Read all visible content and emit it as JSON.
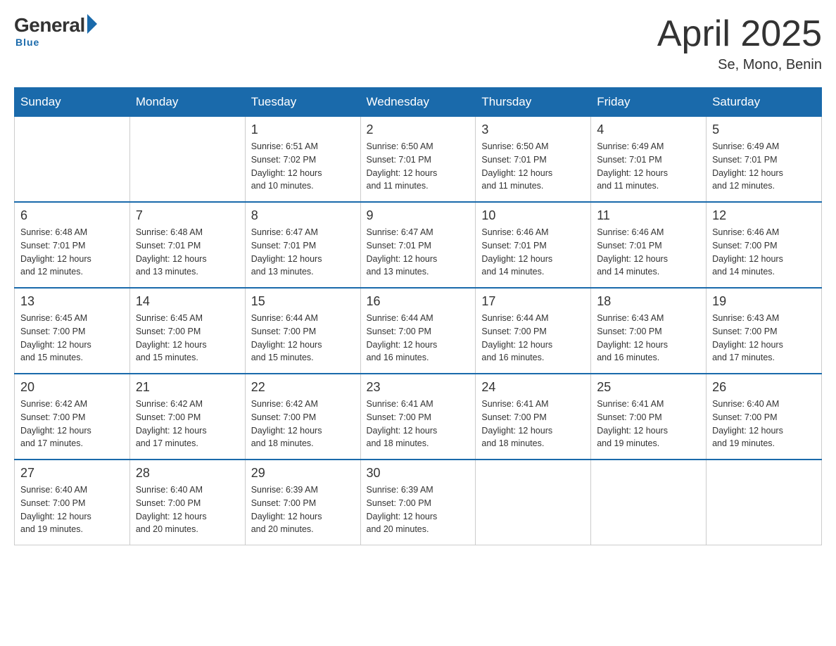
{
  "logo": {
    "general": "General",
    "blue": "Blue",
    "tagline": "Blue"
  },
  "header": {
    "month_year": "April 2025",
    "location": "Se, Mono, Benin"
  },
  "days_of_week": [
    "Sunday",
    "Monday",
    "Tuesday",
    "Wednesday",
    "Thursday",
    "Friday",
    "Saturday"
  ],
  "weeks": [
    [
      {
        "day": "",
        "info": ""
      },
      {
        "day": "",
        "info": ""
      },
      {
        "day": "1",
        "info": "Sunrise: 6:51 AM\nSunset: 7:02 PM\nDaylight: 12 hours\nand 10 minutes."
      },
      {
        "day": "2",
        "info": "Sunrise: 6:50 AM\nSunset: 7:01 PM\nDaylight: 12 hours\nand 11 minutes."
      },
      {
        "day": "3",
        "info": "Sunrise: 6:50 AM\nSunset: 7:01 PM\nDaylight: 12 hours\nand 11 minutes."
      },
      {
        "day": "4",
        "info": "Sunrise: 6:49 AM\nSunset: 7:01 PM\nDaylight: 12 hours\nand 11 minutes."
      },
      {
        "day": "5",
        "info": "Sunrise: 6:49 AM\nSunset: 7:01 PM\nDaylight: 12 hours\nand 12 minutes."
      }
    ],
    [
      {
        "day": "6",
        "info": "Sunrise: 6:48 AM\nSunset: 7:01 PM\nDaylight: 12 hours\nand 12 minutes."
      },
      {
        "day": "7",
        "info": "Sunrise: 6:48 AM\nSunset: 7:01 PM\nDaylight: 12 hours\nand 13 minutes."
      },
      {
        "day": "8",
        "info": "Sunrise: 6:47 AM\nSunset: 7:01 PM\nDaylight: 12 hours\nand 13 minutes."
      },
      {
        "day": "9",
        "info": "Sunrise: 6:47 AM\nSunset: 7:01 PM\nDaylight: 12 hours\nand 13 minutes."
      },
      {
        "day": "10",
        "info": "Sunrise: 6:46 AM\nSunset: 7:01 PM\nDaylight: 12 hours\nand 14 minutes."
      },
      {
        "day": "11",
        "info": "Sunrise: 6:46 AM\nSunset: 7:01 PM\nDaylight: 12 hours\nand 14 minutes."
      },
      {
        "day": "12",
        "info": "Sunrise: 6:46 AM\nSunset: 7:00 PM\nDaylight: 12 hours\nand 14 minutes."
      }
    ],
    [
      {
        "day": "13",
        "info": "Sunrise: 6:45 AM\nSunset: 7:00 PM\nDaylight: 12 hours\nand 15 minutes."
      },
      {
        "day": "14",
        "info": "Sunrise: 6:45 AM\nSunset: 7:00 PM\nDaylight: 12 hours\nand 15 minutes."
      },
      {
        "day": "15",
        "info": "Sunrise: 6:44 AM\nSunset: 7:00 PM\nDaylight: 12 hours\nand 15 minutes."
      },
      {
        "day": "16",
        "info": "Sunrise: 6:44 AM\nSunset: 7:00 PM\nDaylight: 12 hours\nand 16 minutes."
      },
      {
        "day": "17",
        "info": "Sunrise: 6:44 AM\nSunset: 7:00 PM\nDaylight: 12 hours\nand 16 minutes."
      },
      {
        "day": "18",
        "info": "Sunrise: 6:43 AM\nSunset: 7:00 PM\nDaylight: 12 hours\nand 16 minutes."
      },
      {
        "day": "19",
        "info": "Sunrise: 6:43 AM\nSunset: 7:00 PM\nDaylight: 12 hours\nand 17 minutes."
      }
    ],
    [
      {
        "day": "20",
        "info": "Sunrise: 6:42 AM\nSunset: 7:00 PM\nDaylight: 12 hours\nand 17 minutes."
      },
      {
        "day": "21",
        "info": "Sunrise: 6:42 AM\nSunset: 7:00 PM\nDaylight: 12 hours\nand 17 minutes."
      },
      {
        "day": "22",
        "info": "Sunrise: 6:42 AM\nSunset: 7:00 PM\nDaylight: 12 hours\nand 18 minutes."
      },
      {
        "day": "23",
        "info": "Sunrise: 6:41 AM\nSunset: 7:00 PM\nDaylight: 12 hours\nand 18 minutes."
      },
      {
        "day": "24",
        "info": "Sunrise: 6:41 AM\nSunset: 7:00 PM\nDaylight: 12 hours\nand 18 minutes."
      },
      {
        "day": "25",
        "info": "Sunrise: 6:41 AM\nSunset: 7:00 PM\nDaylight: 12 hours\nand 19 minutes."
      },
      {
        "day": "26",
        "info": "Sunrise: 6:40 AM\nSunset: 7:00 PM\nDaylight: 12 hours\nand 19 minutes."
      }
    ],
    [
      {
        "day": "27",
        "info": "Sunrise: 6:40 AM\nSunset: 7:00 PM\nDaylight: 12 hours\nand 19 minutes."
      },
      {
        "day": "28",
        "info": "Sunrise: 6:40 AM\nSunset: 7:00 PM\nDaylight: 12 hours\nand 20 minutes."
      },
      {
        "day": "29",
        "info": "Sunrise: 6:39 AM\nSunset: 7:00 PM\nDaylight: 12 hours\nand 20 minutes."
      },
      {
        "day": "30",
        "info": "Sunrise: 6:39 AM\nSunset: 7:00 PM\nDaylight: 12 hours\nand 20 minutes."
      },
      {
        "day": "",
        "info": ""
      },
      {
        "day": "",
        "info": ""
      },
      {
        "day": "",
        "info": ""
      }
    ]
  ]
}
